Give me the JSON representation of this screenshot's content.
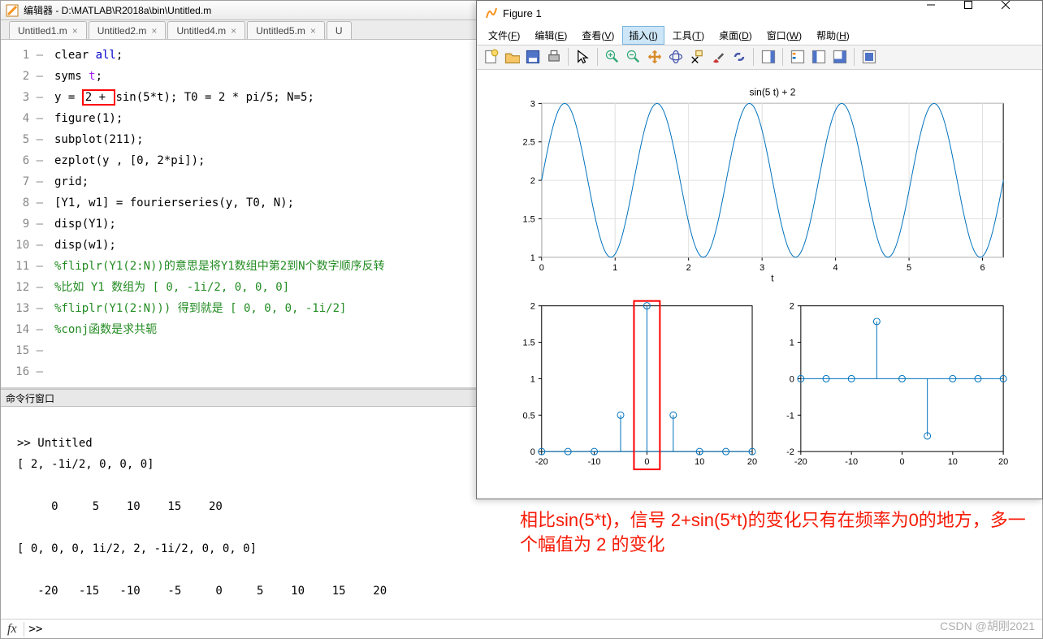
{
  "editor": {
    "title": "编辑器 - D:\\MATLAB\\R2018a\\bin\\Untitled.m",
    "tabs": [
      "Untitled1.m",
      "Untitled2.m",
      "Untitled4.m",
      "Untitled5.m",
      "U"
    ],
    "code_lines": [
      {
        "n": 1,
        "plain": "clear ",
        "kw": "all",
        "tail": ";"
      },
      {
        "n": 2,
        "plain": "syms ",
        "kw": "",
        "sym": "t",
        "tail": ";"
      },
      {
        "n": 3,
        "before": "y = ",
        "boxed": "2 + ",
        "after": "sin(5*t); T0 = 2 * pi/5; N=5;"
      },
      {
        "n": 4,
        "plain": "figure(1);"
      },
      {
        "n": 5,
        "plain": "subplot(211);"
      },
      {
        "n": 6,
        "plain": "ezplot(y , [0, 2*pi]);"
      },
      {
        "n": 7,
        "plain": "grid;"
      },
      {
        "n": 8,
        "plain": ""
      },
      {
        "n": 9,
        "plain": "[Y1, w1] = fourierseries(y, T0, N);"
      },
      {
        "n": 10,
        "plain": "disp(Y1);"
      },
      {
        "n": 11,
        "plain": "disp(w1);"
      },
      {
        "n": 12,
        "plain": ""
      },
      {
        "n": 13,
        "comment": "%fliplr(Y1(2:N))的意思是将Y1数组中第2到N个数字顺序反转"
      },
      {
        "n": 14,
        "comment": "%比如 Y1 数组为 [ 0, -1i/2, 0, 0, 0]"
      },
      {
        "n": 15,
        "comment": "%fliplr(Y1(2:N))) 得到就是 [ 0, 0, 0, -1i/2]"
      },
      {
        "n": 16,
        "comment": "%conj函数是求共轭"
      }
    ]
  },
  "cmdwin": {
    "title": "命令行窗口",
    "lines": [
      "",
      ">> Untitled",
      "[ 2, -1i/2, 0, 0, 0]",
      "",
      "     0     5    10    15    20",
      "",
      "[ 0, 0, 0, 1i/2, 2, -1i/2, 0, 0, 0]",
      "",
      "   -20   -15   -10    -5     0     5    10    15    20",
      ""
    ],
    "fx_prompt": ">>"
  },
  "figure": {
    "title": "Figure 1",
    "menus": [
      {
        "label": "文件",
        "key": "F"
      },
      {
        "label": "编辑",
        "key": "E"
      },
      {
        "label": "查看",
        "key": "V"
      },
      {
        "label": "插入",
        "key": "I",
        "active": true
      },
      {
        "label": "工具",
        "key": "T"
      },
      {
        "label": "桌面",
        "key": "D"
      },
      {
        "label": "窗口",
        "key": "W"
      },
      {
        "label": "帮助",
        "key": "H"
      }
    ],
    "toolbar_icons": [
      "new-file",
      "open-file",
      "save",
      "print",
      "sep",
      "pointer",
      "sep",
      "zoom-in",
      "zoom-out",
      "pan",
      "rotate3d",
      "data-cursor",
      "brush",
      "link",
      "sep",
      "insert-colorbar",
      "sep",
      "insert-legend",
      "hide-plot-tools",
      "show-plot-tools",
      "sep",
      "dock"
    ]
  },
  "chart_data": [
    {
      "type": "line",
      "title": "sin(5 t) + 2",
      "xlabel": "t",
      "xlim": [
        0,
        6.2832
      ],
      "ylim": [
        1,
        3
      ],
      "xticks": [
        0,
        1,
        2,
        3,
        4,
        5,
        6
      ],
      "yticks": [
        1,
        1.5,
        2,
        2.5,
        3
      ],
      "expr": "2+sin(5*t)"
    },
    {
      "type": "stem",
      "xlim": [
        -20,
        20
      ],
      "ylim": [
        0,
        2
      ],
      "xticks": [
        -20,
        -10,
        0,
        10,
        20
      ],
      "yticks": [
        0,
        0.5,
        1,
        1.5,
        2
      ],
      "x": [
        -20,
        -15,
        -10,
        -5,
        0,
        5,
        10,
        15,
        20
      ],
      "y": [
        0,
        0,
        0,
        0.5,
        2,
        0.5,
        0,
        0,
        0
      ],
      "highlight_x": 0
    },
    {
      "type": "stem",
      "xlim": [
        -20,
        20
      ],
      "ylim": [
        -2,
        2
      ],
      "xticks": [
        -20,
        -10,
        0,
        10,
        20
      ],
      "yticks": [
        -2,
        -1,
        0,
        1,
        2
      ],
      "x": [
        -20,
        -15,
        -10,
        -5,
        0,
        5,
        10,
        15,
        20
      ],
      "y": [
        0,
        0,
        0,
        1.5708,
        0,
        -1.5708,
        0,
        0,
        0
      ]
    }
  ],
  "annotation": "相比sin(5*t)，信号 2+sin(5*t)的变化只有在频率为0的地方，多一个幅值为 2 的变化",
  "watermark": "CSDN @胡刚2021"
}
